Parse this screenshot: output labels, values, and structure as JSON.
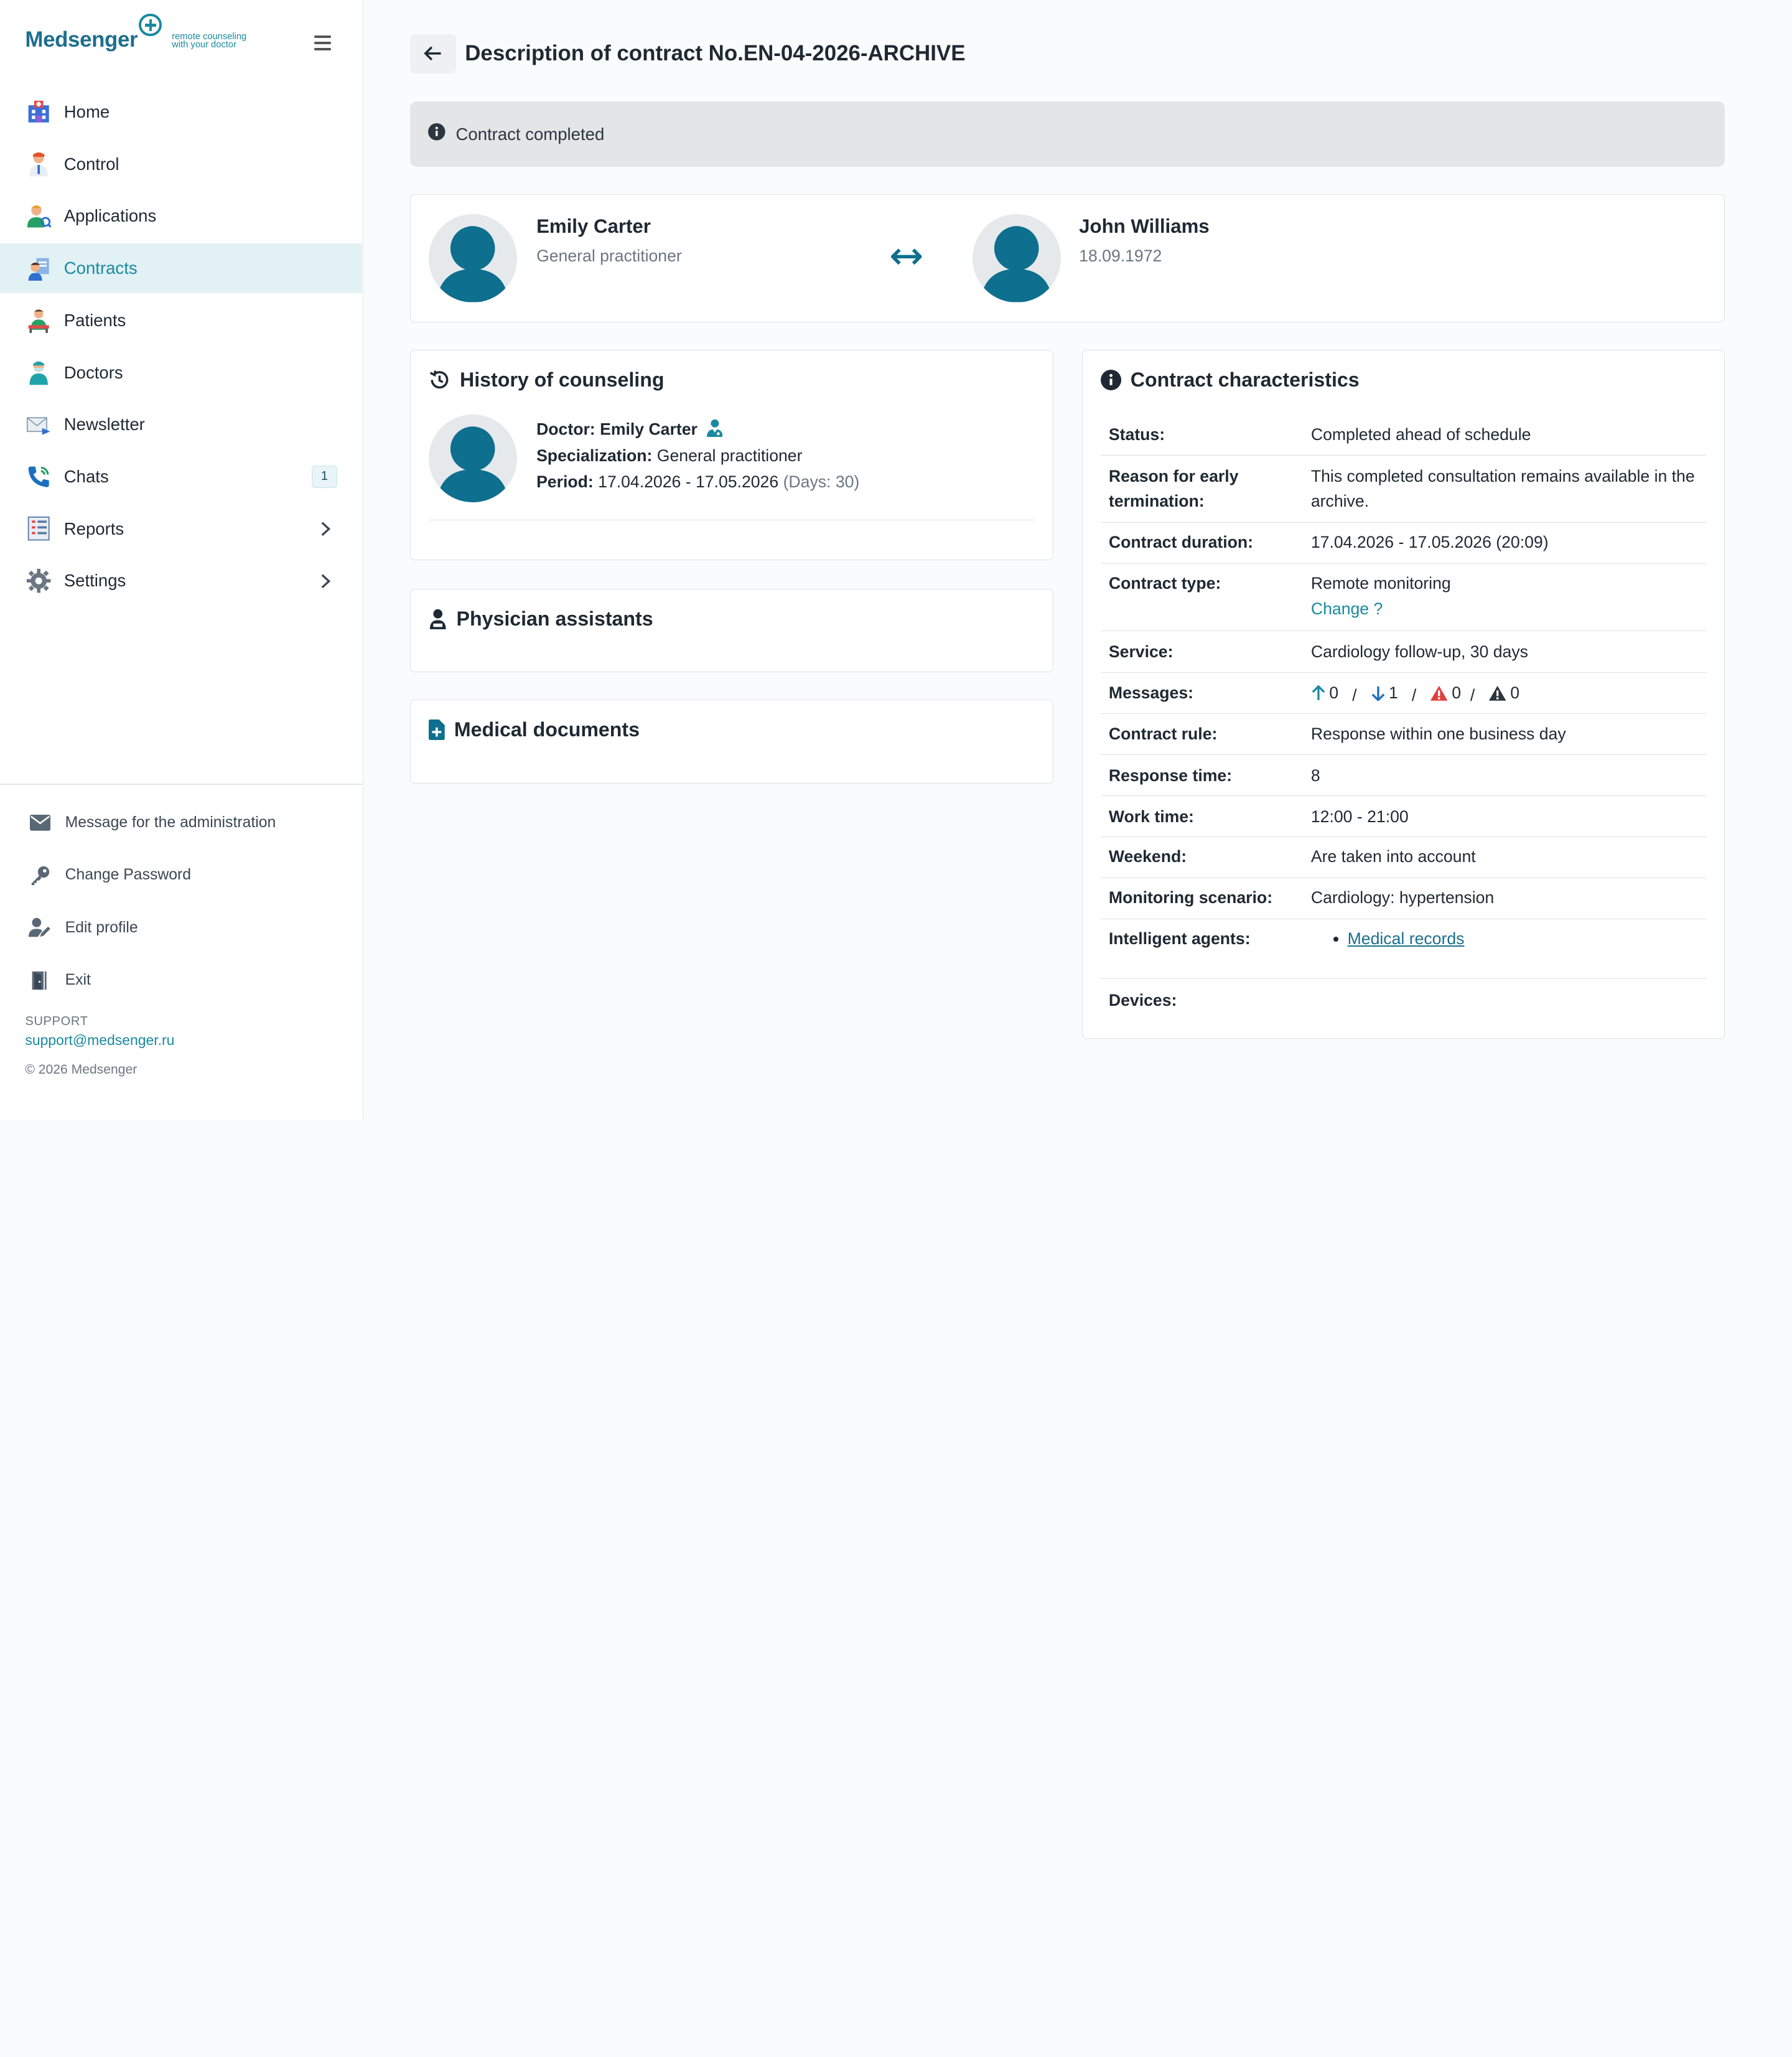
{
  "logo": {
    "word": "Medsenger",
    "tagline_1": "remote counseling",
    "tagline_2": "with your doctor"
  },
  "nav": {
    "home": "Home",
    "control": "Control",
    "applications": "Applications",
    "contracts": "Contracts",
    "patients": "Patients",
    "doctors": "Doctors",
    "newsletter": "Newsletter",
    "chats": "Chats",
    "chats_badge": "1",
    "reports": "Reports",
    "settings": "Settings"
  },
  "footer_nav": {
    "message_admin": "Message for the administration",
    "change_password": "Change Password",
    "edit_profile": "Edit profile",
    "exit": "Exit"
  },
  "support": {
    "label": "SUPPORT",
    "email": "support@medsenger.ru",
    "copyright": "© 2026 Medsenger"
  },
  "page": {
    "title": "Description of contract No.EN-04-2026-ARCHIVE"
  },
  "alert": {
    "text": "Contract completed"
  },
  "participants": {
    "doctor_name": "Emily Carter",
    "doctor_role": "General practitioner",
    "patient_name": "John Williams",
    "patient_dob": "18.09.1972"
  },
  "history": {
    "title": "History of counseling",
    "doctor_label": "Doctor:",
    "doctor_value": "Emily Carter",
    "spec_label": "Specialization:",
    "spec_value": "General practitioner",
    "period_label": "Period:",
    "period_value": "17.04.2026 - 17.05.2026",
    "period_days": "(Days: 30)"
  },
  "assistants": {
    "title": "Physician assistants"
  },
  "documents": {
    "title": "Medical documents"
  },
  "characteristics": {
    "title": "Contract characteristics",
    "status_k": "Status:",
    "status_v": "Completed ahead of schedule",
    "reason_k": "Reason for early termination:",
    "reason_v": "This completed consultation remains available in the archive.",
    "duration_k": "Contract duration:",
    "duration_v": "17.04.2026 - 17.05.2026 (20:09)",
    "type_k": "Contract type:",
    "type_v": "Remote monitoring",
    "type_change": "Change ?",
    "service_k": "Service:",
    "service_v": "Cardiology follow-up, 30 days",
    "messages_k": "Messages:",
    "msg_out": "0",
    "msg_in": "1",
    "msg_warn_red": "0",
    "msg_warn_dark": "0",
    "msg_sep": "/",
    "rule_k": "Contract rule:",
    "rule_v": "Response within one business day",
    "response_k": "Response time:",
    "response_v": "8",
    "work_k": "Work time:",
    "work_v": "12:00 - 21:00",
    "weekend_k": "Weekend:",
    "weekend_v": "Are taken into account",
    "scenario_k": "Monitoring scenario:",
    "scenario_v": "Cardiology: hypertension",
    "agents_k": "Intelligent agents:",
    "agents_v": "Medical records",
    "devices_k": "Devices:"
  },
  "colors": {
    "accent": "#1a8aa0",
    "avatar": "#0e6f8e",
    "active_bg": "#e1f1f4",
    "alert_bg": "#e4e5e7"
  }
}
